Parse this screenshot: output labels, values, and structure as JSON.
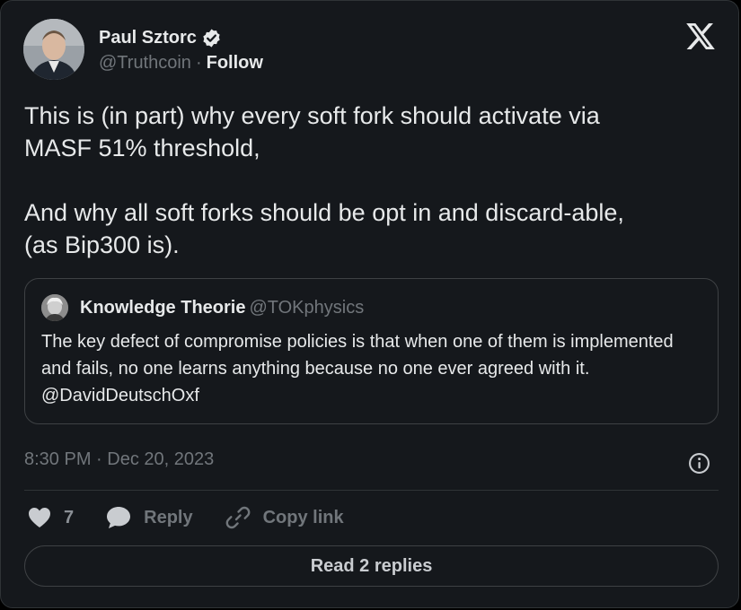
{
  "author": {
    "name": "Paul Sztorc",
    "handle": "@Truthcoin",
    "separator": "·",
    "follow_label": "Follow"
  },
  "icons": {
    "avatar": "profile-photo",
    "verified": "verified-badge-icon",
    "logo": "x-logo-icon",
    "info": "info-icon",
    "like": "heart-icon",
    "reply": "speech-bubble-icon",
    "copy": "link-icon"
  },
  "tweet": {
    "text": "This is (in part) why every soft fork should activate via\nMASF 51% threshold,\n\nAnd why all soft forks should be opt in and discard-able,\n(as Bip300 is)."
  },
  "quote": {
    "name": "Knowledge Theorie",
    "handle": "@TOKphysics",
    "text": "The key defect of compromise policies is that when one of them is implemented and fails, no one learns anything because no one ever agreed with it. @DavidDeutschOxf"
  },
  "meta": {
    "time": "8:30 PM",
    "separator": "·",
    "date": "Dec 20, 2023"
  },
  "actions": {
    "like_count": "7",
    "reply_label": "Reply",
    "copy_label": "Copy link"
  },
  "footer": {
    "read_replies_label": "Read 2 replies"
  },
  "colors": {
    "background": "#15181c",
    "text": "#e7e9ea",
    "muted": "#71767b",
    "border": "#2f3336"
  }
}
